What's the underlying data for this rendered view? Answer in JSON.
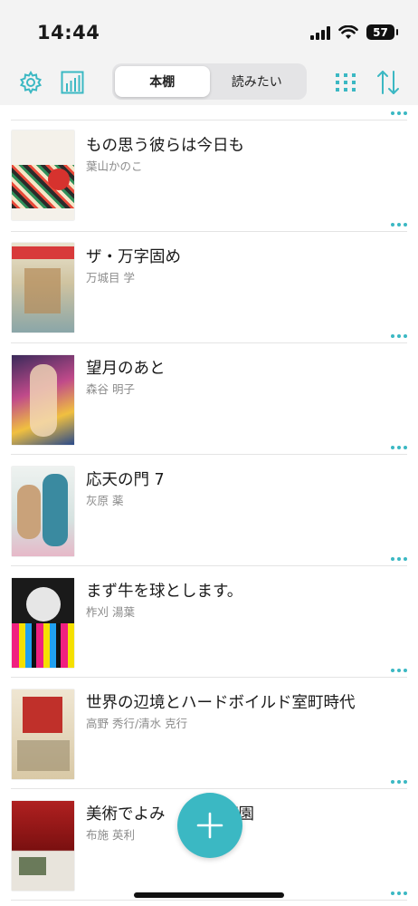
{
  "status_bar": {
    "time": "14:44",
    "battery": "57"
  },
  "toolbar": {
    "tabs": [
      {
        "label": "本棚",
        "active": true
      },
      {
        "label": "読みたい",
        "active": false
      }
    ],
    "icons": [
      "gear-icon",
      "bar-chart-icon",
      "grid-view-icon",
      "sort-icon"
    ],
    "accent_color": "#3bb8c3"
  },
  "books": [
    {
      "title": "",
      "author": ""
    },
    {
      "title": "もの思う彼らは今日も",
      "author": "葉山かのこ"
    },
    {
      "title": "ザ・万字固め",
      "author": "万城目 学"
    },
    {
      "title": "望月のあと",
      "author": "森谷 明子"
    },
    {
      "title": "応天の門 7",
      "author": "灰原 薬"
    },
    {
      "title": "まず牛を球とします。",
      "author": "柞刈 湯葉"
    },
    {
      "title": "世界の辺境とハードボイルド室町時代",
      "author": "高野 秀行/清水 克行"
    },
    {
      "title": "美術でよみ",
      "author": "布施 英利",
      "title_tail": "の庭園"
    }
  ],
  "fab": {
    "icon": "plus-icon"
  }
}
